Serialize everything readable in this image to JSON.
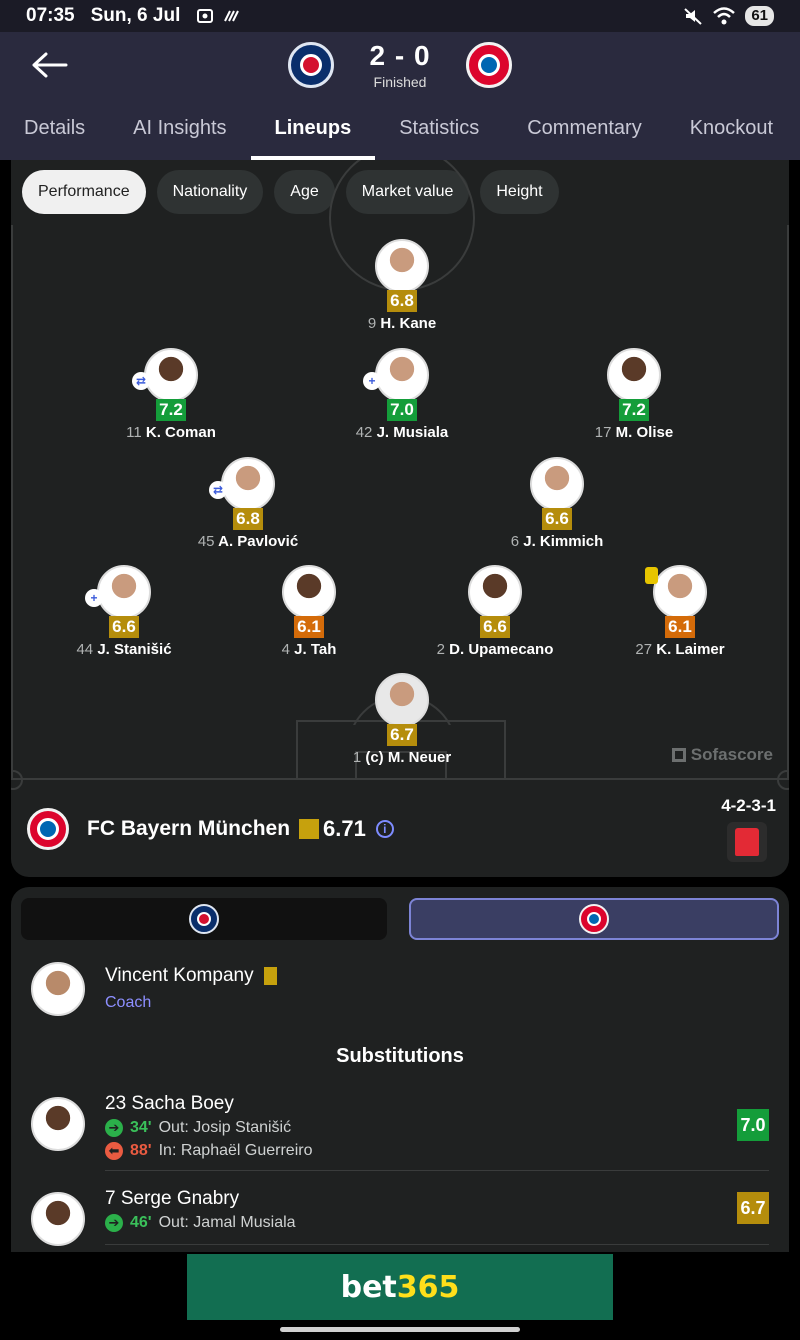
{
  "status_bar": {
    "time": "07:35",
    "date": "Sun, 6 Jul",
    "battery": "61"
  },
  "match": {
    "score": "2 - 0",
    "status": "Finished"
  },
  "tabs": [
    "Details",
    "AI Insights",
    "Lineups",
    "Statistics",
    "Commentary",
    "Knockout"
  ],
  "filters": [
    "Performance",
    "Nationality",
    "Age",
    "Market value",
    "Height"
  ],
  "watermark": "Sofascore",
  "players": [
    {
      "num": "9",
      "name": "H. Kane",
      "rating": "6.8",
      "color": "yellow"
    },
    {
      "num": "11",
      "name": "K. Coman",
      "rating": "7.2",
      "color": "green"
    },
    {
      "num": "42",
      "name": "J. Musiala",
      "rating": "7.0",
      "color": "green"
    },
    {
      "num": "17",
      "name": "M. Olise",
      "rating": "7.2",
      "color": "green"
    },
    {
      "num": "45",
      "name": "A. Pavlović",
      "rating": "6.8",
      "color": "yellow"
    },
    {
      "num": "6",
      "name": "J. Kimmich",
      "rating": "6.6",
      "color": "yellow"
    },
    {
      "num": "44",
      "name": "J. Stanišić",
      "rating": "6.6",
      "color": "yellow"
    },
    {
      "num": "4",
      "name": "J. Tah",
      "rating": "6.1",
      "color": "orange"
    },
    {
      "num": "2",
      "name": "D. Upamecano",
      "rating": "6.6",
      "color": "yellow"
    },
    {
      "num": "27",
      "name": "K. Laimer",
      "rating": "6.1",
      "color": "orange"
    },
    {
      "num": "1",
      "name": "(c) M. Neuer",
      "rating": "6.7",
      "color": "yellow"
    }
  ],
  "team": {
    "name": "FC Bayern München",
    "rating": "6.71",
    "formation": "4-2-3-1"
  },
  "coach": {
    "name": "Vincent Kompany",
    "role": "Coach"
  },
  "subs_title": "Substitutions",
  "subs": [
    {
      "name": "23 Sacha Boey",
      "in_min": "34'",
      "in_text": "Out: Josip Stanišić",
      "out_min": "88'",
      "out_text": "In: Raphaël Guerreiro",
      "rating": "7.0"
    },
    {
      "name": "7 Serge Gnabry",
      "in_min": "46'",
      "in_text": "Out: Jamal Musiala",
      "rating": "6.7"
    }
  ],
  "ad": {
    "part1": "bet",
    "part2": "365"
  },
  "colors": {
    "green": "#149d3a",
    "yellow": "#b58d0c",
    "orange": "#d46b09",
    "accent": "#8d8fff"
  }
}
